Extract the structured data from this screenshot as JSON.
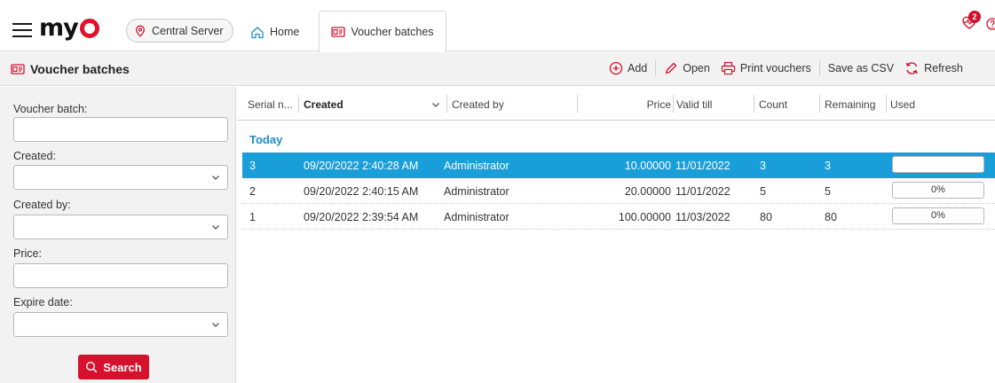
{
  "header": {
    "logo_text": "my",
    "server_label": "Central Server",
    "tabs": [
      {
        "label": "Home",
        "icon": "home-icon"
      },
      {
        "label": "Voucher batches",
        "icon": "voucher-icon",
        "active": true
      }
    ],
    "notification_count": "2"
  },
  "page": {
    "title": "Voucher batches",
    "toolbar": {
      "add": "Add",
      "open": "Open",
      "print": "Print vouchers",
      "csv": "Save as CSV",
      "refresh": "Refresh"
    }
  },
  "filters": {
    "voucher_batch_label": "Voucher batch:",
    "voucher_batch_value": "",
    "created_label": "Created:",
    "created_value": "",
    "created_by_label": "Created by:",
    "created_by_value": "",
    "price_label": "Price:",
    "price_value": "",
    "expire_label": "Expire date:",
    "expire_value": "",
    "search_label": "Search"
  },
  "grid": {
    "columns": [
      "Serial n...",
      "Created",
      "Created by",
      "Price",
      "Valid till",
      "Count",
      "Remaining",
      "Used"
    ],
    "group": "Today",
    "rows": [
      {
        "serial": "3",
        "created": "09/20/2022 2:40:28 AM",
        "created_by": "Administrator",
        "price": "10.00000",
        "valid_till": "11/01/2022",
        "count": "3",
        "remaining": "3",
        "used": "",
        "used_fraction": 0,
        "selected": true
      },
      {
        "serial": "2",
        "created": "09/20/2022 2:40:15 AM",
        "created_by": "Administrator",
        "price": "20.00000",
        "valid_till": "11/01/2022",
        "count": "5",
        "remaining": "5",
        "used": "0%",
        "used_fraction": 0,
        "selected": false
      },
      {
        "serial": "1",
        "created": "09/20/2022 2:39:54 AM",
        "created_by": "Administrator",
        "price": "100.00000",
        "valid_till": "11/03/2022",
        "count": "80",
        "remaining": "80",
        "used": "0%",
        "used_fraction": 0,
        "selected": false
      }
    ]
  },
  "colors": {
    "brand_red": "#e3112b",
    "selection_blue": "#1a9ed9",
    "group_blue": "#1a8fcf"
  }
}
